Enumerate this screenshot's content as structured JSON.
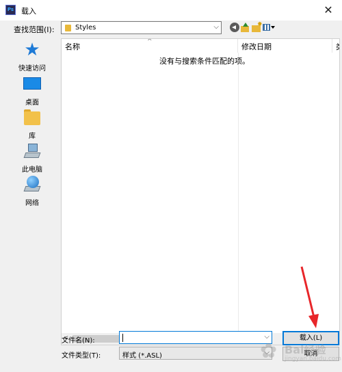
{
  "window": {
    "app_icon_text": "Ps",
    "title": "载入",
    "close_symbol": "✕"
  },
  "toolbar": {
    "lookin_label": "查找范围(I):",
    "lookin_value": "Styles",
    "back_icon": "back-circle-icon",
    "up_icon": "folder-up-icon",
    "new_folder_icon": "new-folder-icon",
    "views_icon": "view-menu-icon"
  },
  "places": [
    {
      "label": "快速访问",
      "icon": "star-icon"
    },
    {
      "label": "桌面",
      "icon": "desktop-icon"
    },
    {
      "label": "库",
      "icon": "library-folder-icon"
    },
    {
      "label": "此电脑",
      "icon": "computer-icon"
    },
    {
      "label": "网络",
      "icon": "network-icon"
    }
  ],
  "list": {
    "col_name": "名称",
    "col_date": "修改日期",
    "col_type": "类",
    "empty_message": "没有与搜索条件匹配的项。"
  },
  "form": {
    "filename_label": "文件名(N):",
    "filename_value": "",
    "filetype_label": "文件类型(T):",
    "filetype_value": "样式 (*.ASL)"
  },
  "buttons": {
    "load": "载入(L)",
    "cancel": "取消"
  },
  "watermark": {
    "text": "Bai经验",
    "sub": "jingyan.baidu.com"
  },
  "colors": {
    "accent": "#0078d7",
    "annotation_arrow": "#e8262a"
  }
}
